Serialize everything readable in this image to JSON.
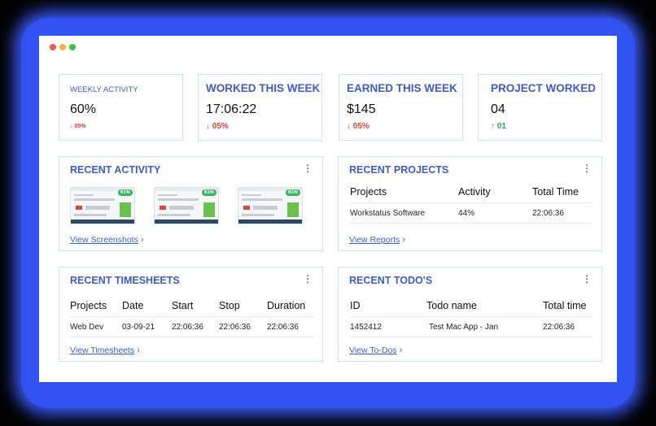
{
  "stats": [
    {
      "title": "WEEKLY ACTIVITY",
      "value": "60%",
      "change": "05%",
      "direction": "down",
      "arrow": "↓"
    },
    {
      "title": "WORKED THIS WEEK",
      "value": "17:06:22",
      "change": "05%",
      "direction": "down",
      "arrow": "↓"
    },
    {
      "title": "EARNED THIS WEEK",
      "value": "$145",
      "change": "05%",
      "direction": "down",
      "arrow": "↓"
    },
    {
      "title": "PROJECT WORKED",
      "value": "04",
      "change": "01",
      "direction": "up",
      "arrow": "↑"
    }
  ],
  "recent_activity": {
    "title": "RECENT ACTIVITY",
    "screenshots": [
      {
        "badge": "61%"
      },
      {
        "badge": "61%"
      },
      {
        "badge": "61%"
      }
    ],
    "link": "View Screenshots"
  },
  "recent_projects": {
    "title": "RECENT PROJECTS",
    "columns": [
      "Projects",
      "Activity",
      "Total Time"
    ],
    "rows": [
      [
        "Workstatus Software",
        "44%",
        "22:06:36"
      ]
    ],
    "link": "View Reports"
  },
  "recent_timesheets": {
    "title": "RECENT TIMESHEETS",
    "columns": [
      "Projects",
      "Date",
      "Start",
      "Stop",
      "Duration"
    ],
    "rows": [
      [
        "Web Dev",
        "03-09-21",
        "22:06:36",
        "22:06:36",
        "22:06:36"
      ]
    ],
    "link": "View Timesheets"
  },
  "recent_todos": {
    "title": "RECENT TODO'S",
    "columns": [
      "ID",
      "Todo name",
      "Total time"
    ],
    "rows": [
      [
        "1452412",
        "Test Mac App - Jan",
        "22:06:36"
      ]
    ],
    "link": "View To-Dos"
  },
  "icons": {
    "kebab": "⋮",
    "chevron": "›"
  },
  "colors": {
    "accent": "#3f5bc7",
    "down": "#e0413b",
    "up": "#2ea44f",
    "border": "#cfe0ef",
    "glow": "#2f52f0"
  }
}
